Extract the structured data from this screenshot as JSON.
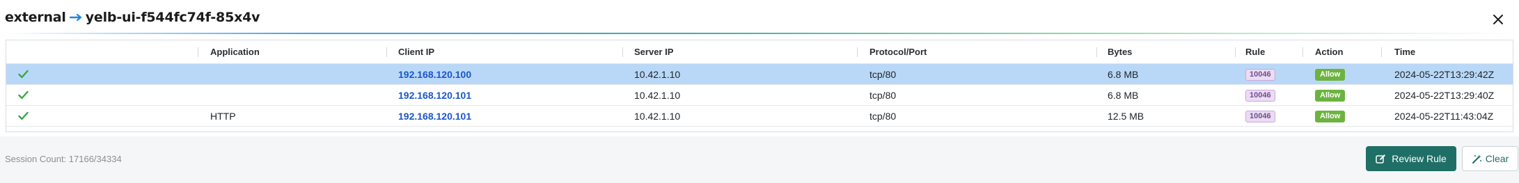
{
  "title": {
    "source": "external",
    "destination": "yelb-ui-f544fc74f-85x4v"
  },
  "table": {
    "columns": [
      "Application",
      "Client IP",
      "Server IP",
      "Protocol/Port",
      "Bytes",
      "Rule",
      "Action",
      "Time"
    ],
    "rows": [
      {
        "status": "ok",
        "selected": true,
        "application": "",
        "client_ip": "192.168.120.100",
        "server_ip": "10.42.1.10",
        "protocol_port": "tcp/80",
        "bytes": "6.8 MB",
        "rule": "10046",
        "action": "Allow",
        "time": "2024-05-22T13:29:42Z"
      },
      {
        "status": "ok",
        "selected": false,
        "application": "",
        "client_ip": "192.168.120.101",
        "server_ip": "10.42.1.10",
        "protocol_port": "tcp/80",
        "bytes": "6.8 MB",
        "rule": "10046",
        "action": "Allow",
        "time": "2024-05-22T13:29:40Z"
      },
      {
        "status": "ok",
        "selected": false,
        "application": "HTTP",
        "client_ip": "192.168.120.101",
        "server_ip": "10.42.1.10",
        "protocol_port": "tcp/80",
        "bytes": "12.5 MB",
        "rule": "10046",
        "action": "Allow",
        "time": "2024-05-22T11:43:04Z"
      }
    ]
  },
  "footer": {
    "session_count": "Session Count: 17166/34334",
    "review_rule_label": "Review Rule",
    "clear_label": "Clear"
  },
  "icons": {
    "arrow": "arrow-right-icon",
    "close": "close-icon",
    "check": "check-icon",
    "review": "edit-icon",
    "clear": "eraser-wand-icon"
  },
  "colors": {
    "selected_row": "#b9d8f7",
    "ip_link": "#1a56c9",
    "allow_badge": "#6cb33f",
    "rule_badge_bg": "#ecdcf3",
    "primary_button": "#1f6f66",
    "check": "#3aa64a"
  }
}
